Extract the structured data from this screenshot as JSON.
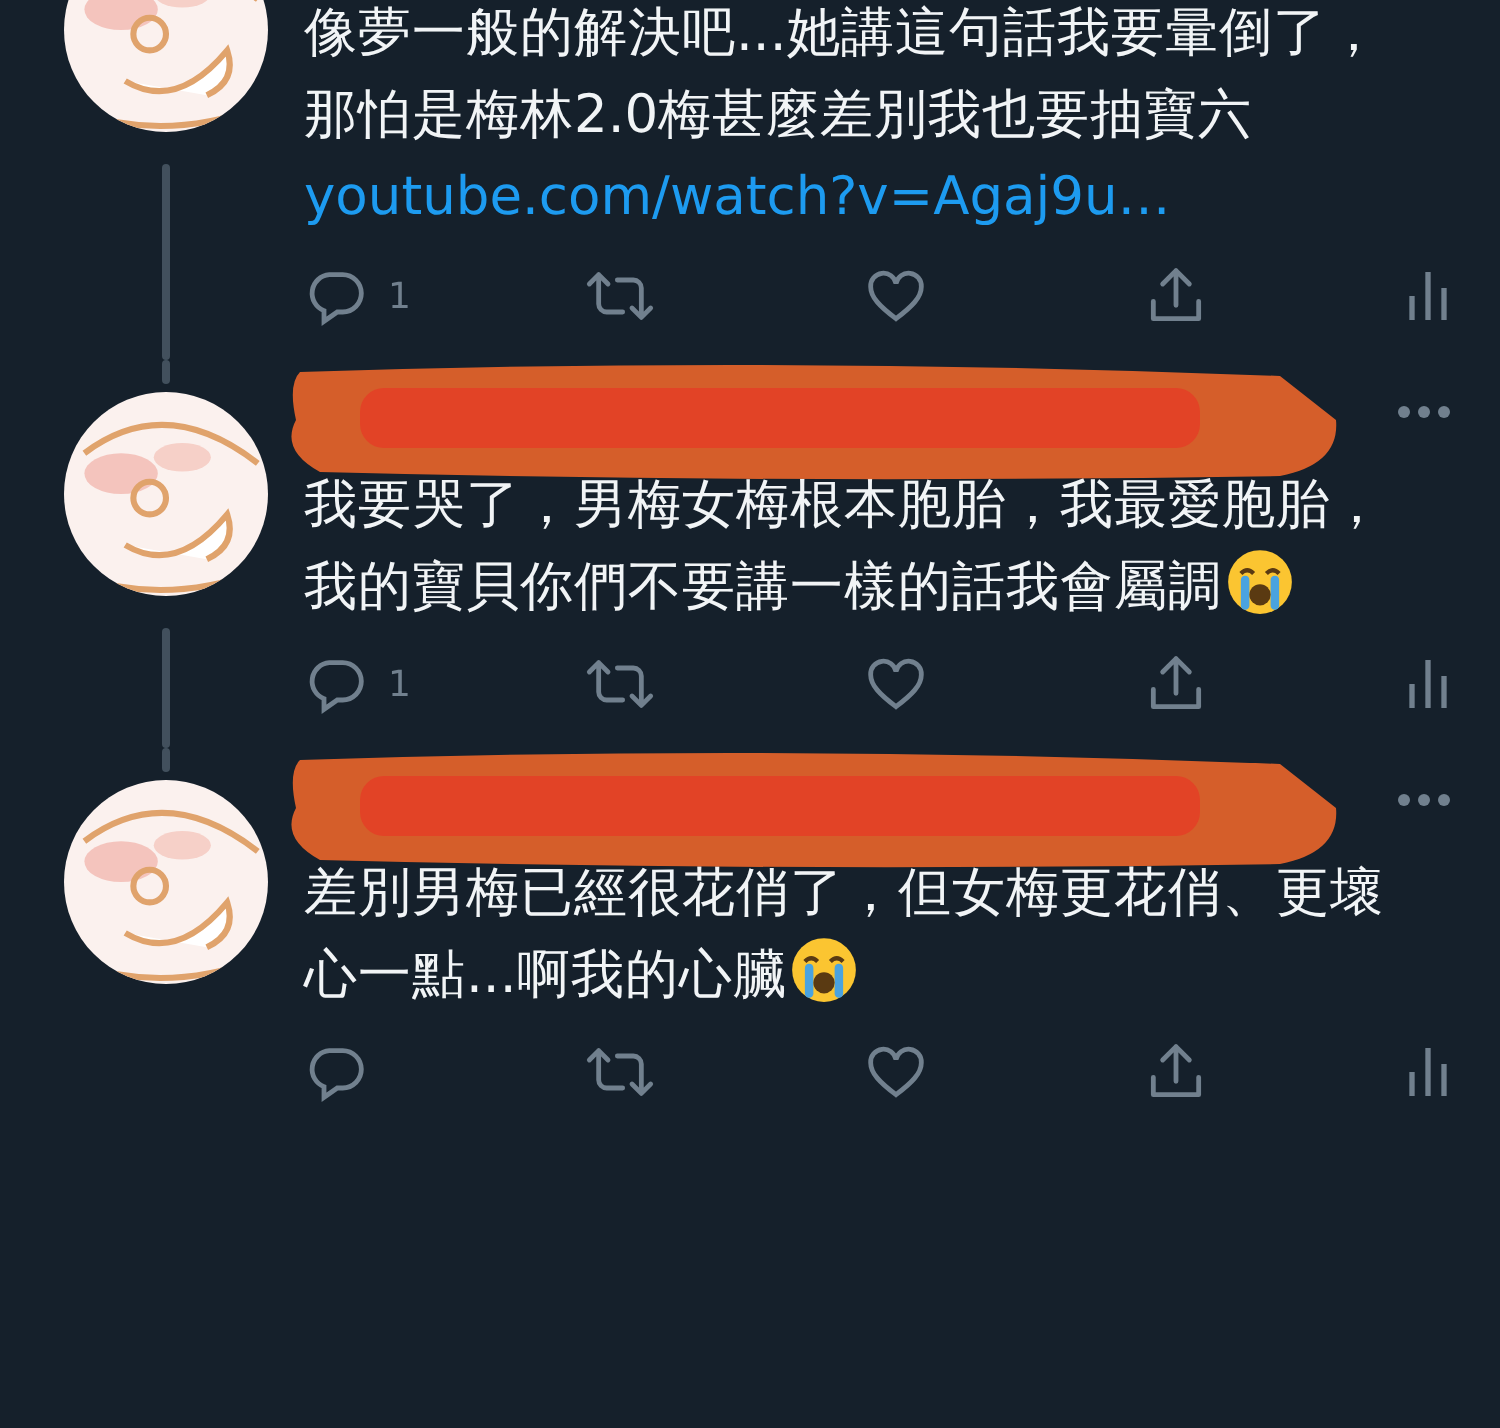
{
  "tweets": [
    {
      "header_redacted": false,
      "text": "像夢一般的解決吧...她講這句話我要暈倒了，那怕是梅林2.0梅甚麼差別我也要抽寶六",
      "crying_emoji": false,
      "link": "youtube.com/watch?v=Agaj9u…",
      "reply_count": "1",
      "thread_above": false,
      "thread_below": true
    },
    {
      "header_redacted": true,
      "text": "我要哭了，男梅女梅根本胞胎，我最愛胞胎，我的寶貝你們不要講一樣的話我會屬調",
      "crying_emoji": true,
      "reply_count": "1",
      "thread_above": true,
      "thread_below": true
    },
    {
      "header_redacted": true,
      "text": "差別男梅已經很花俏了，但女梅更花俏、更壞心一點...啊我的心臟",
      "crying_emoji": true,
      "thread_above": true,
      "thread_below": false
    }
  ]
}
